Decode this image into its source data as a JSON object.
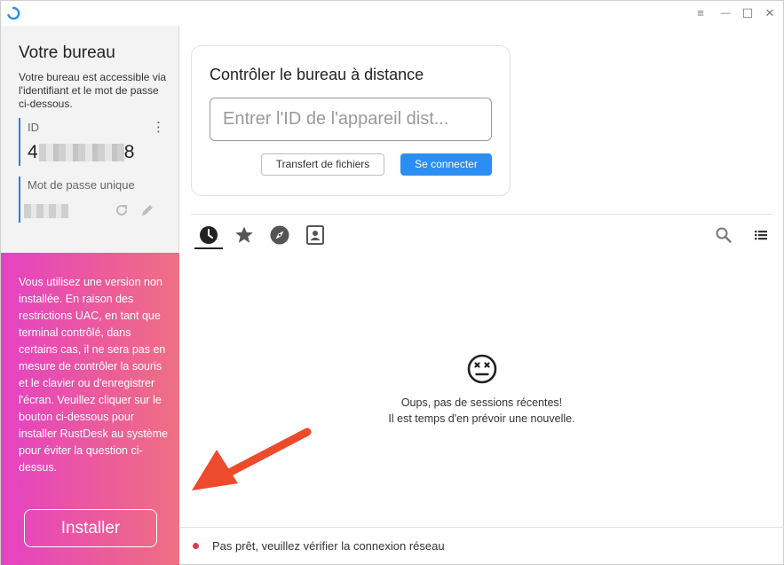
{
  "window": {
    "controls": {
      "menu": "≡",
      "minimize": "—",
      "maximize": "☐",
      "close": "✕"
    }
  },
  "left": {
    "title": "Votre bureau",
    "description": "Votre bureau est accessible via l'identifiant et le mot de passe ci-dessous.",
    "id_label": "ID",
    "id_value_start": "4",
    "id_value_end": "8",
    "password_label": "Mot de passe unique",
    "warning": "Vous utilisez une version non installée. En raison des restrictions UAC, en tant que terminal contrôlé, dans certains cas, il ne sera pas en mesure de contrôler la souris et le clavier ou d'enregistrer l'écran. Veuillez cliquer sur le bouton ci-dessous pour installer RustDesk au système pour éviter la question ci-dessus.",
    "install_label": "Installer"
  },
  "connect": {
    "title": "Contrôler le bureau à distance",
    "placeholder": "Entrer l'ID de l'appareil dist...",
    "files_button": "Transfert de fichiers",
    "connect_button": "Se connecter"
  },
  "tabs": [
    {
      "name": "recent",
      "icon": "clock-icon"
    },
    {
      "name": "favorites",
      "icon": "star-icon"
    },
    {
      "name": "discovered",
      "icon": "compass-icon"
    },
    {
      "name": "address-book",
      "icon": "address-book-icon"
    }
  ],
  "empty": {
    "line1": "Oups, pas de sessions récentes!",
    "line2": "Il est temps d'en prévoir une nouvelle."
  },
  "status": {
    "text": "Pas prêt, veuillez vérifier la connexion réseau",
    "color": "#e0394c"
  },
  "colors": {
    "accent": "#2b8ef0",
    "warning_gradient_start": "#e542c4",
    "warning_gradient_end": "#f07082",
    "arrow": "#ee4a2c"
  }
}
